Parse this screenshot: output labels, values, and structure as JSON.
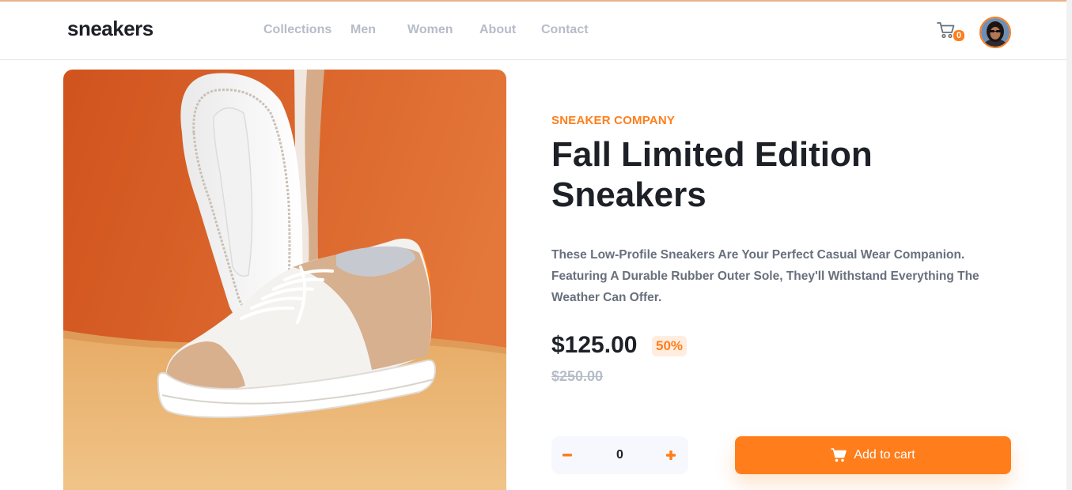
{
  "header": {
    "logo": "sneakers",
    "nav": [
      {
        "label": "Collections"
      },
      {
        "label": "Men"
      },
      {
        "label": "Women"
      },
      {
        "label": "About"
      },
      {
        "label": "Contact"
      }
    ],
    "cart": {
      "icon": "cart-icon",
      "count": "0"
    },
    "avatar": {
      "icon": "user-avatar"
    }
  },
  "product": {
    "company": "SNEAKER COMPANY",
    "title": "Fall Limited Edition Sneakers",
    "description": "These Low-Profile Sneakers Are Your Perfect Casual Wear Companion. Featuring A Durable Rubber Outer Sole, They'll Withstand Everything The Weather Can Offer.",
    "price": "$125.00",
    "discount": "50%",
    "original_price": "$250.00",
    "image": "sneaker-product-photo"
  },
  "purchase": {
    "quantity": "0",
    "minus_icon": "minus-icon",
    "plus_icon": "plus-icon",
    "add_to_cart_label": "Add to cart",
    "add_icon": "cart-icon"
  },
  "colors": {
    "accent": "#ff7e1b",
    "accent_pale": "#ffede0",
    "dark": "#1d2026",
    "muted": "#68707d",
    "light_muted": "#b6bcc8"
  }
}
